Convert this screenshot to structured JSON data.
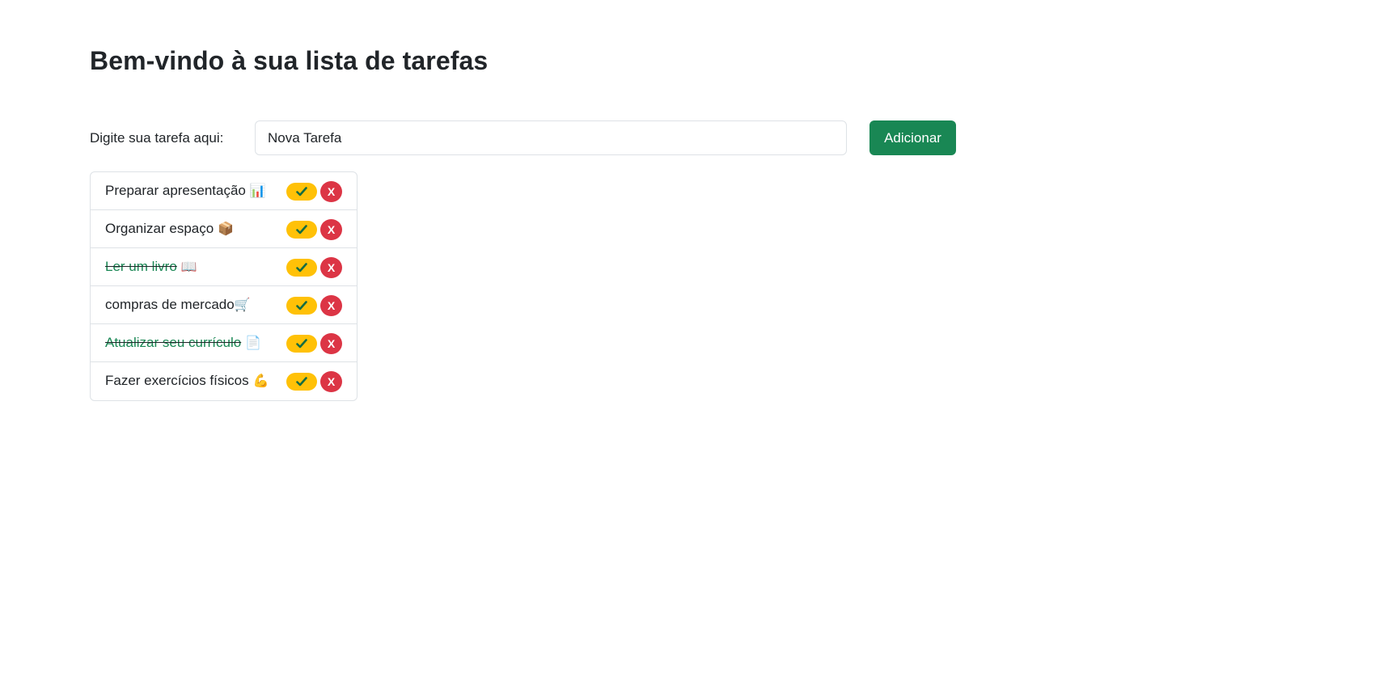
{
  "header": {
    "title": "Bem-vindo à sua lista de tarefas"
  },
  "form": {
    "label": "Digite sua tarefa aqui:",
    "input_value": "Nova Tarefa",
    "add_label": "Adicionar"
  },
  "tasks": [
    {
      "text": "Preparar apresentação",
      "emoji": "📊",
      "done": false,
      "complete_icon": "check-icon",
      "delete_label": "X"
    },
    {
      "text": "Organizar espaço",
      "emoji": "📦",
      "done": false,
      "complete_icon": "check-icon",
      "delete_label": "X"
    },
    {
      "text": "Ler um livro",
      "emoji": "📖",
      "done": true,
      "complete_icon": "check-icon",
      "delete_label": "X"
    },
    {
      "text": "compras de mercado",
      "emoji": "🛒",
      "done": false,
      "complete_icon": "check-icon",
      "delete_label": "X"
    },
    {
      "text": "Atualizar seu currículo",
      "emoji": "📄",
      "done": true,
      "complete_icon": "check-icon",
      "delete_label": "X"
    },
    {
      "text": "Fazer exercícios físicos",
      "emoji": "💪",
      "done": false,
      "complete_icon": "check-icon",
      "delete_label": "X"
    }
  ],
  "colors": {
    "add_button": "#198754",
    "complete_button": "#ffc107",
    "delete_button": "#dc3545",
    "done_text": "#198754"
  }
}
